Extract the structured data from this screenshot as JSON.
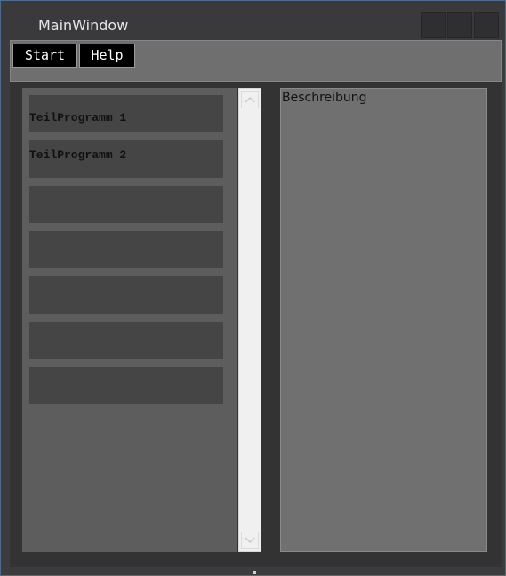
{
  "window": {
    "title": "MainWindow"
  },
  "toolbar": {
    "start_label": "Start",
    "help_label": "Help"
  },
  "program_list": {
    "items": [
      {
        "label": "TeilProgramm 1"
      },
      {
        "label": "TeilProgramm 2"
      },
      {
        "label": ""
      },
      {
        "label": ""
      },
      {
        "label": ""
      },
      {
        "label": ""
      },
      {
        "label": ""
      }
    ]
  },
  "description": {
    "text": "Beschreibung"
  },
  "icons": {
    "scroll_up": "chevron-up-icon",
    "scroll_down": "chevron-down-icon"
  },
  "colors": {
    "toolbar_bg": "#6f6f6f",
    "button_bg": "#000000",
    "list_item_bg": "#454545",
    "description_bg": "#707070"
  }
}
